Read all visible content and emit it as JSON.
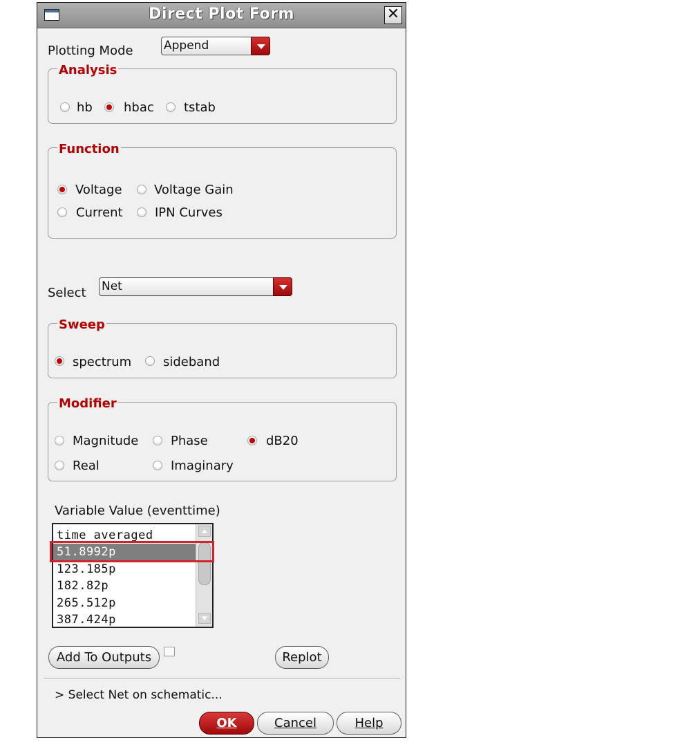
{
  "window": {
    "title": "Direct Plot Form",
    "close_glyph": "✕"
  },
  "plotting_mode": {
    "label": "Plotting Mode",
    "value": "Append"
  },
  "analysis": {
    "title": "Analysis",
    "options": [
      "hb",
      "hbac",
      "tstab"
    ],
    "selected": "hbac"
  },
  "function": {
    "title": "Function",
    "options": [
      "Voltage",
      "Voltage Gain",
      "Current",
      "IPN Curves"
    ],
    "selected": "Voltage"
  },
  "select": {
    "label": "Select",
    "value": "Net"
  },
  "sweep": {
    "title": "Sweep",
    "options": [
      "spectrum",
      "sideband"
    ],
    "selected": "spectrum"
  },
  "modifier": {
    "title": "Modifier",
    "options": [
      "Magnitude",
      "Phase",
      "dB20",
      "Real",
      "Imaginary"
    ],
    "selected": "dB20"
  },
  "variable": {
    "label": "Variable Value (eventtime)",
    "items": [
      "time averaged",
      "51.8992p",
      "123.185p",
      "182.82p",
      "265.512p",
      "387.424p"
    ],
    "selected": "51.8992p"
  },
  "buttons": {
    "add_to_outputs": "Add To Outputs",
    "replot": "Replot",
    "ok": "OK",
    "cancel": "Cancel",
    "help": "Help"
  },
  "status": "> Select Net on schematic...",
  "colors": {
    "accent_red": "#c40000",
    "group_title": "#b30000",
    "highlight_box": "#d2222c"
  }
}
